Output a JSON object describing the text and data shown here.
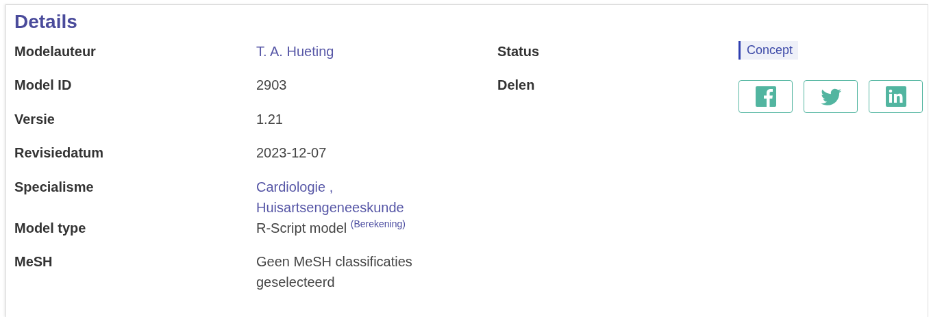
{
  "title": "Details",
  "fields": [
    {
      "label": "Modelauteur",
      "kind": "links",
      "links": [
        "T. A. Hueting"
      ]
    },
    {
      "label": "Model ID",
      "kind": "text",
      "value": "2903"
    },
    {
      "label": "Versie",
      "kind": "text",
      "value": "1.21"
    },
    {
      "label": "Revisiedatum",
      "kind": "text",
      "value": "2023-12-07"
    },
    {
      "label": "Specialisme",
      "kind": "links",
      "links": [
        "Cardiologie ,",
        "Huisartsengeneeskunde"
      ]
    },
    {
      "label": "Model type",
      "kind": "text",
      "value": "R-Script model",
      "note": "(Berekening)"
    },
    {
      "label": "MeSH",
      "kind": "text",
      "value": "Geen MeSH classificaties geselecteerd"
    }
  ],
  "status": {
    "label": "Status",
    "value": "Concept"
  },
  "share": {
    "label": "Delen",
    "buttons": [
      {
        "kind": "facebook"
      },
      {
        "kind": "twitter"
      },
      {
        "kind": "linkedin"
      }
    ]
  }
}
